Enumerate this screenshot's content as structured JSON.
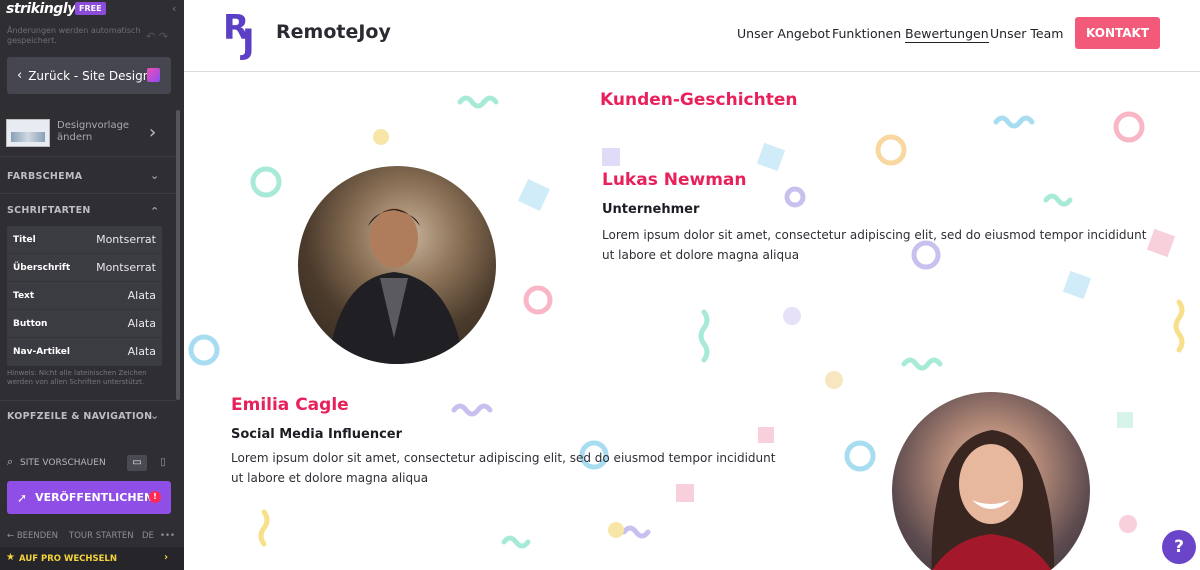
{
  "editor": {
    "logo": "strikingly",
    "badge": "FREE",
    "autosave_note": "Änderungen werden automatisch gespeichert.",
    "back_button": "Zurück - Site Design",
    "template_label": "Designvorlage ändern",
    "sections": {
      "color_scheme": "FARBSCHEMA",
      "fonts": "SCHRIFTARTEN",
      "header_nav": "KOPFZEILE & NAVIGATION"
    },
    "fonts": [
      {
        "key": "Titel",
        "value": "Montserrat"
      },
      {
        "key": "Überschrift",
        "value": "Montserrat"
      },
      {
        "key": "Text",
        "value": "Alata"
      },
      {
        "key": "Button",
        "value": "Alata"
      },
      {
        "key": "Nav-Artikel",
        "value": "Alata"
      }
    ],
    "font_hint": "Hinweis: Nicht alle lateinischen Zeichen werden von allen Schriften unterstützt.",
    "preview_label": "SITE VORSCHAUEN",
    "publish_button": "VERÖFFENTLICHEN",
    "bottom_links": {
      "quit": "BEENDEN",
      "tour": "TOUR STARTEN",
      "lang": "DE",
      "more": "•••"
    },
    "pro_bar": "AUF PRO WECHSELN"
  },
  "site": {
    "brand_initials": {
      "r": "R",
      "j": "J"
    },
    "brand_name": "RemoteJoy",
    "nav": [
      "Unser Angebot",
      "Funktionen",
      "Bewertungen",
      "Unser Team"
    ],
    "cta": "KONTAKT",
    "section_title": "Kunden-Geschichten",
    "testimonials": [
      {
        "name": "Lukas Newman",
        "role": "Unternehmer",
        "text": "Lorem ipsum dolor sit amet, consectetur adipiscing elit, sed do eiusmod tempor incididunt ut labore et dolore magna aliqua"
      },
      {
        "name": "Emilia Cagle",
        "role": "Social Media Influencer",
        "text": "Lorem ipsum dolor sit amet, consectetur adipiscing elit, sed do eiusmod tempor incididunt ut labore et dolore magna aliqua"
      }
    ],
    "help": "?"
  },
  "colors": {
    "sidebar_bg": "#2e2e33",
    "publish": "#8f4ee6",
    "accent_pink": "#e8215a",
    "cta": "#f35a7a",
    "brand_purple": "#5b3fc4"
  }
}
